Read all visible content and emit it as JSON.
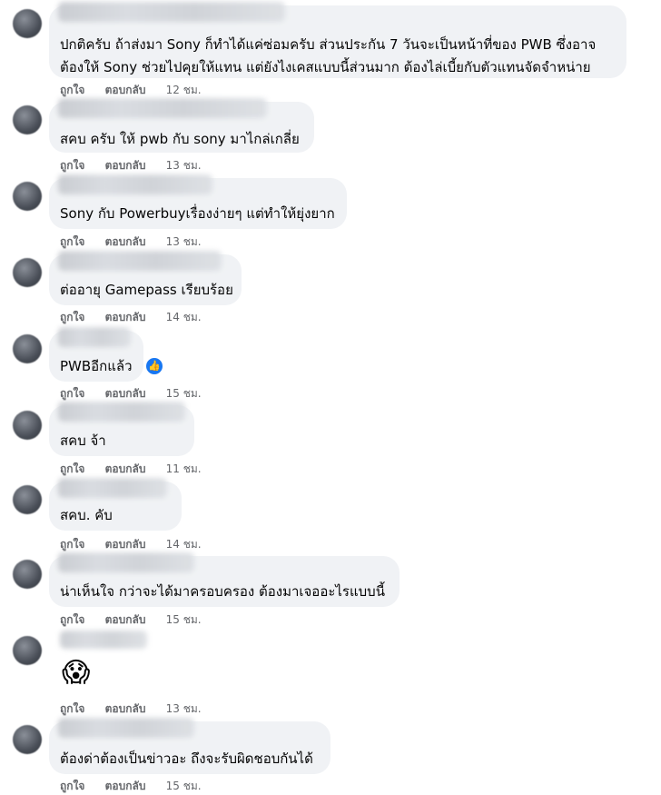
{
  "actions": {
    "like_label": "ถูกใจ",
    "reply_label": "ตอบกลับ"
  },
  "comments": [
    {
      "lines": [
        "ปกติครับ ถ้าส่งมา Sony ก็ทำได้แค่ซ่อมครับ ส่วนประกัน 7 วันจะเป็นหน้าที่ของ PWB ซึ่งอาจ",
        "ต้องให้ Sony ช่วยไปคุยให้แทน แต่ยังไงเคสแบบนี้ส่วนมาก ต้องไล่เบี้ยกับตัวแทนจัดจำหน่าย"
      ],
      "time": "12 ชม."
    },
    {
      "lines": [
        "สคบ ครับ ให้ pwb กับ sony มาไกล่เกลี่ย"
      ],
      "time": "13 ชม."
    },
    {
      "lines": [
        "Sony กับ Powerbuyเรื่องง่ายๆ แต่ทำให้ยุ่งยาก"
      ],
      "time": "13 ชม."
    },
    {
      "lines": [
        "ต่ออายุ Gamepass เรียบร้อย"
      ],
      "time": "14 ชม."
    },
    {
      "lines": [
        "PWBอีกแล้ว"
      ],
      "time": "15 ชม.",
      "reaction": "like-reaction"
    },
    {
      "lines": [
        "สคบ จ้า"
      ],
      "time": "11 ชม."
    },
    {
      "lines": [
        "สคบ. คับ"
      ],
      "time": "14 ชม."
    },
    {
      "lines": [
        "น่าเห็นใจ กว่าจะได้มาครอบครอง ต้องมาเจออะไรแบบนี้"
      ],
      "time": "15 ชม."
    },
    {
      "emoji": "😱",
      "time": "13 ชม."
    },
    {
      "lines": [
        "ต้องด่าต้องเป็นข่าวอะ ถึงจะรับผิดชอบกันได้"
      ],
      "time": "15 ชม."
    }
  ]
}
